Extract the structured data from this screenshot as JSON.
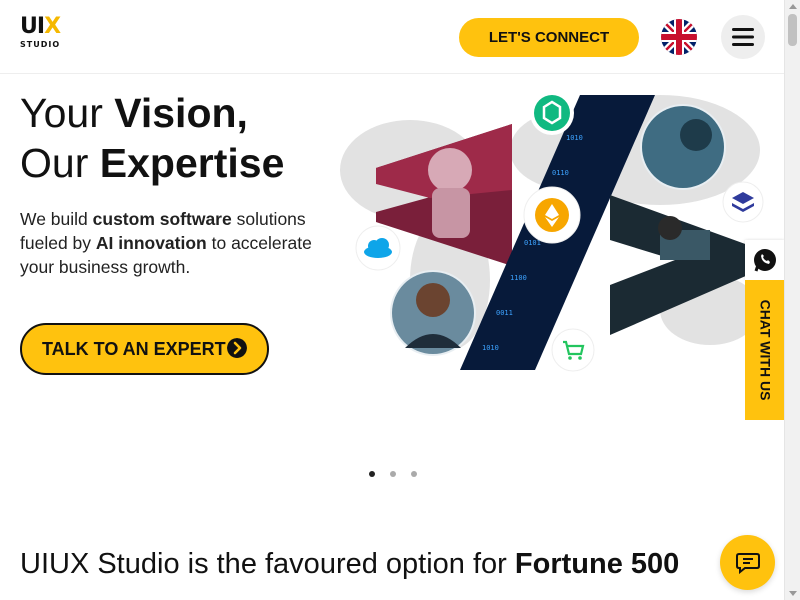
{
  "header": {
    "logo_text": "UIUX",
    "logo_sub": "STUDIO",
    "connect_label": "LET'S CONNECT"
  },
  "hero": {
    "title_line1_light": "Your",
    "title_line1_bold": "Vision,",
    "title_line2_light": "Our",
    "title_line2_bold": "Expertise",
    "desc_1": "We build",
    "desc_bold_1": "custom software",
    "desc_2": "solutions fueled by",
    "desc_bold_2": "AI innovation",
    "desc_3": "to accelerate your business growth.",
    "cta_label": "TALK TO AN EXPERT"
  },
  "carousel": {
    "slides": 3,
    "active": 1
  },
  "intro": {
    "line_light": "UIUX Studio is the favoured option for",
    "line_bold": "Fortune 500"
  },
  "side_chat": {
    "label": "CHAT WITH US"
  },
  "colors": {
    "accent": "#ffc20e",
    "dark": "#111111"
  },
  "icons": [
    "uk-flag-icon",
    "hamburger-menu-icon",
    "arrow-right-circle-icon",
    "whatsapp-icon",
    "chat-icon",
    "cloud-icon",
    "cart-icon",
    "ethereum-icon",
    "layers-icon",
    "blockchain-icon"
  ]
}
